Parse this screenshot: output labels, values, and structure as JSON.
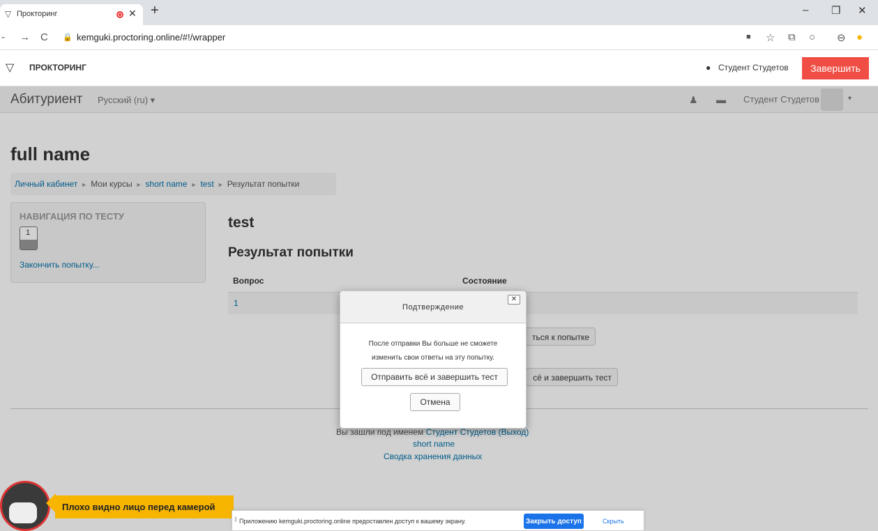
{
  "browser": {
    "tab_title": "Прокторинг",
    "url": "kemguki.proctoring.online/#!/wrapper"
  },
  "proctoring": {
    "title": "ПРОКТОРИНГ",
    "user": "Студент Студетов",
    "finish_label": "Завершить"
  },
  "moodle_nav": {
    "site_name": "Абитуриент",
    "language": "Русский (ru) ▾",
    "user": "Студент Студетов"
  },
  "page": {
    "heading": "full name",
    "breadcrumb": [
      "Личный кабинет",
      "Мои курсы",
      "short name",
      "test",
      "Результат попытки"
    ]
  },
  "quiz_nav": {
    "title": "НАВИГАЦИЯ ПО ТЕСТУ",
    "question_number": "1",
    "finish_attempt": "Закончить попытку..."
  },
  "main": {
    "title": "test",
    "subtitle": "Результат попытки",
    "col_question": "Вопрос",
    "col_state": "Состояние",
    "row_number": "1",
    "return_btn": "ться к попытке",
    "submit_btn": "сё и завершить тест"
  },
  "footer": {
    "login_prefix": "Вы зашли под именем",
    "login_user": "Студент Студетов (Выход)",
    "course": "short name",
    "data_summary": "Сводка хранения данных"
  },
  "modal": {
    "title": "Подтверждение",
    "close": "✕",
    "text": "После отправки Вы больше не сможете изменить свои ответы на эту попытку.",
    "submit_label": "Отправить всё и завершить тест",
    "cancel_label": "Отмена"
  },
  "camera_warning": "Плохо видно лицо перед камерой",
  "share_bar": {
    "text": "Приложению kemguki.proctoring.online предоставлен доступ к вашему экрану.",
    "stop_label": "Закрыть доступ",
    "hide_label": "Скрыть"
  }
}
